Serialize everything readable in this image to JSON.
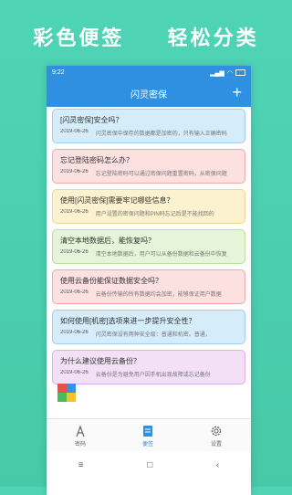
{
  "slogan": {
    "part1": "彩色便签",
    "part2": "轻松分类"
  },
  "statusbar": {
    "time": "9:22"
  },
  "appbar": {
    "title": "闪灵密保",
    "add_label": "+"
  },
  "notes": [
    {
      "title": "[闪灵密保]安全吗？",
      "date": "2019-06-26",
      "excerpt": "闪灵密保中保存的数据都是加密的，只有输入正确密码",
      "bg": "#d5ecfb",
      "border": "#9fd0f2"
    },
    {
      "title": "忘记登陆密码怎么办？",
      "date": "2019-06-26",
      "excerpt": "忘记登陆密码可以通过密保问题重置密码，从密保问题",
      "bg": "#fde0e0",
      "border": "#f3a9a9"
    },
    {
      "title": "使用[闪灵密保]需要牢记哪些信息？",
      "date": "2019-06-26",
      "excerpt": "用户设置的密保问题和PIN码忘记后是不能找回的",
      "bg": "#fdf2cf",
      "border": "#f0d98a"
    },
    {
      "title": "清空本地数据后，能恢复吗？",
      "date": "2019-06-26",
      "excerpt": "清空本地数据后，用户可以从备份数据和云备份中恢复",
      "bg": "#e6f4d9",
      "border": "#b9df99"
    },
    {
      "title": "使用云备份能保证数据安全吗？",
      "date": "2019-06-26",
      "excerpt": "云备份传输的所有数据均会加密，能够保证用户数据",
      "bg": "#fde0e0",
      "border": "#f3a9a9"
    },
    {
      "title": "如何使用[机密]选项来进一步提升安全性？",
      "date": "2019-06-26",
      "excerpt": "闪灵密保设有两种安全级：普通和机密。普通，",
      "bg": "#d5ecfb",
      "border": "#9fd0f2"
    },
    {
      "title": "为什么建议使用云备份？",
      "date": "2019-06-26",
      "excerpt": "云备份是为避免用户因手机出现故障或忘记备份",
      "bg": "#f3e0f6",
      "border": "#dcb0e6"
    }
  ],
  "tile_colors": [
    "#e94d4d",
    "#3d8fe6",
    "#4dba5a",
    "#f2c230"
  ],
  "bottomnav": [
    {
      "label": "密码",
      "icon": "password-icon",
      "active": false
    },
    {
      "label": "便签",
      "icon": "note-icon",
      "active": true
    },
    {
      "label": "设置",
      "icon": "gear-icon",
      "active": false
    }
  ],
  "sysbar": {
    "menu": "≡",
    "home": "□",
    "back": "‹"
  }
}
